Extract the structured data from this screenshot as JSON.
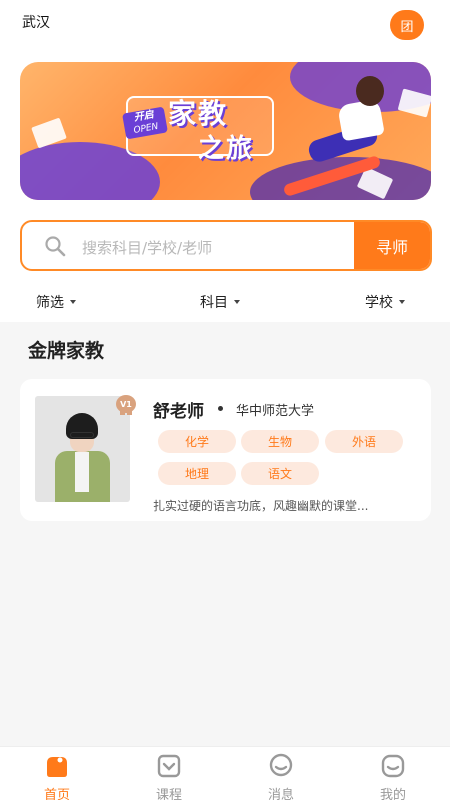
{
  "header": {
    "city": "武汉",
    "group_icon_label": "团"
  },
  "banner": {
    "open_cn": "开启",
    "open_en": "OPEN",
    "title_line1": "家教",
    "title_line2": "之旅"
  },
  "search": {
    "placeholder": "搜索科目/学校/老师",
    "button": "寻师"
  },
  "filters": [
    {
      "label": "筛选"
    },
    {
      "label": "科目"
    },
    {
      "label": "学校"
    }
  ],
  "section": {
    "title": "金牌家教"
  },
  "teacher": {
    "name": "舒老师",
    "school": "华中师范大学",
    "level": "V1",
    "tags": [
      "化学",
      "生物",
      "外语",
      "地理",
      "语文"
    ],
    "intro": "扎实过硬的语言功底，风趣幽默的课堂..."
  },
  "tabbar": {
    "items": [
      {
        "label": "首页",
        "icon": "home-icon",
        "active": true
      },
      {
        "label": "课程",
        "icon": "course-icon",
        "active": false
      },
      {
        "label": "消息",
        "icon": "message-icon",
        "active": false
      },
      {
        "label": "我的",
        "icon": "profile-icon",
        "active": false
      }
    ]
  },
  "colors": {
    "accent": "#ff7a1a",
    "tag_bg": "#fde9de",
    "page_bg": "#f6f6f6"
  }
}
